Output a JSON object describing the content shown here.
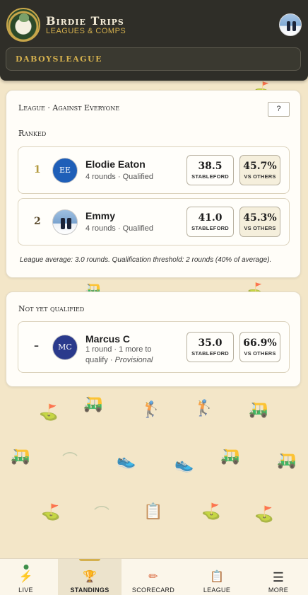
{
  "header": {
    "brand_title": "Birdie Trips",
    "brand_subtitle": "Leagues & Comps",
    "league_selector": "DABOYSLEAGUE"
  },
  "standings": {
    "card_title": "League · Against Everyone",
    "help_label": "?",
    "ranked_label": "Ranked",
    "ranked": [
      {
        "rank": "1",
        "initials": "EE",
        "name": "Elodie Eaton",
        "subtitle": "4 rounds · Qualified",
        "stableford": "38.5",
        "stableford_label": "STABLEFORD",
        "vs_others": "45.7%",
        "vs_others_label": "VS OTHERS"
      },
      {
        "rank": "2",
        "initials": "",
        "name": "Emmy",
        "subtitle": "4 rounds · Qualified",
        "stableford": "41.0",
        "stableford_label": "STABLEFORD",
        "vs_others": "45.3%",
        "vs_others_label": "VS OTHERS"
      }
    ],
    "footnote": "League average: 3.0 rounds. Qualification threshold: 2 rounds (40% of average).",
    "not_qualified_label": "Not yet qualified",
    "not_qualified": [
      {
        "rank": "–",
        "initials": "MC",
        "name": "Marcus C",
        "subtitle_prefix": "1 round · 1 more to qualify · ",
        "subtitle_status": "Provisional",
        "stableford": "35.0",
        "stableford_label": "STABLEFORD",
        "vs_others": "66.9%",
        "vs_others_label": "VS OTHERS"
      }
    ]
  },
  "nav": {
    "items": [
      {
        "label": "LIVE",
        "icon": "lightning-icon"
      },
      {
        "label": "STANDINGS",
        "icon": "trophy-icon"
      },
      {
        "label": "SCORECARD",
        "icon": "pencil-icon"
      },
      {
        "label": "LEAGUE",
        "icon": "clipboard-icon"
      },
      {
        "label": "MORE",
        "icon": "menu-icon"
      }
    ],
    "active": "STANDINGS"
  },
  "colors": {
    "header_bg": "#2f2e28",
    "accent_gold": "#d4b04e",
    "page_bg": "#f3e6c8",
    "live_dot": "#3f8f4a"
  }
}
